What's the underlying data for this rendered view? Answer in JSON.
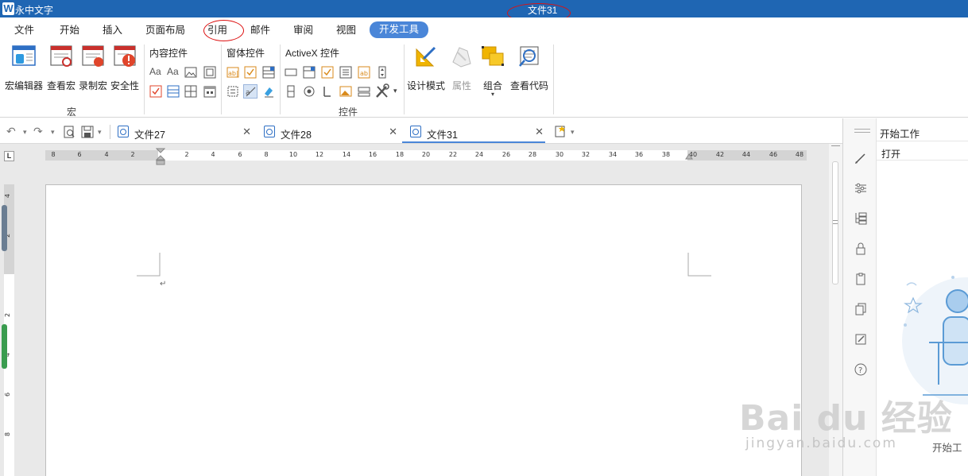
{
  "titlebar": {
    "app_name": "永中文字",
    "doc_title": "文件31"
  },
  "menu": [
    "文件",
    "开始",
    "插入",
    "页面布局",
    "引用",
    "邮件",
    "审阅",
    "视图",
    "开发工具"
  ],
  "menu_active": "开发工具",
  "ribbon": {
    "macro_group": {
      "label": "宏",
      "buttons": [
        "宏编辑器",
        "查看宏",
        "录制宏",
        "安全性"
      ]
    },
    "controls_group": {
      "label": "控件",
      "content_controls_title": "内容控件",
      "form_controls_title": "窗体控件",
      "activex_title": "ActiveX 控件",
      "buttons": [
        "设计模式",
        "属性",
        "组合",
        "查看代码"
      ]
    }
  },
  "tabs": [
    {
      "name": "文件27"
    },
    {
      "name": "文件28"
    },
    {
      "name": "文件31"
    }
  ],
  "ruler": {
    "h_ticks": [
      "8",
      "6",
      "4",
      "2",
      "2",
      "4",
      "6",
      "8",
      "10",
      "12",
      "14",
      "16",
      "18",
      "20",
      "22",
      "24",
      "26",
      "28",
      "30",
      "32",
      "34",
      "36",
      "38",
      "40",
      "42",
      "44",
      "46",
      "48"
    ],
    "v_ticks": [
      "4",
      "2",
      "2",
      "4",
      "6",
      "8"
    ]
  },
  "task_pane": {
    "title": "开始工作",
    "open_label": "打开",
    "footer": "开始工"
  },
  "watermark": {
    "brand": "Bai du 经验",
    "url": "jingyan.baidu.com"
  },
  "colors": {
    "titlebar": "#1f66b3",
    "accent": "#4a86d8",
    "annotation": "#dd1111"
  }
}
